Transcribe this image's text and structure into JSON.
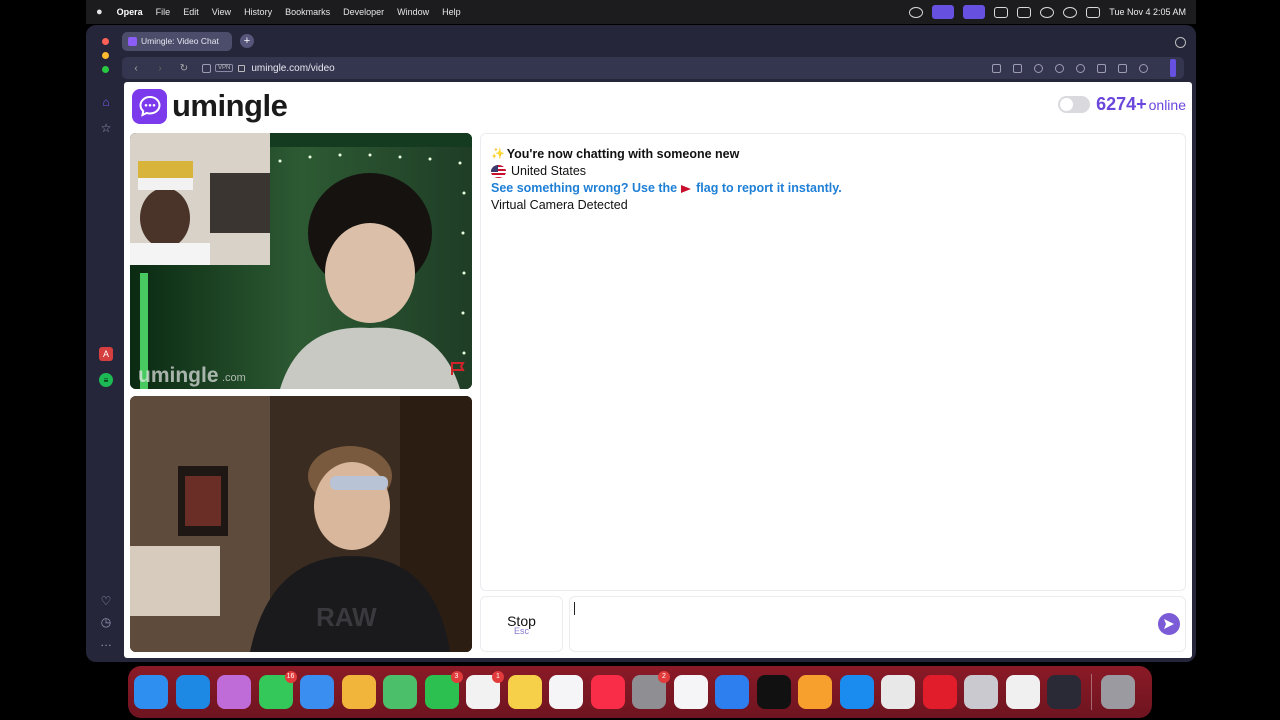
{
  "menubar": {
    "app": "Opera",
    "items": [
      "File",
      "Edit",
      "View",
      "History",
      "Bookmarks",
      "Developer",
      "Window",
      "Help"
    ],
    "clock": "Tue Nov 4  2:05 AM"
  },
  "browser": {
    "tab_title": "Umingle: Video Chat",
    "vpn_label": "VPN",
    "url": "umingle.com/video"
  },
  "site": {
    "brand": "umingle",
    "online_count": "6274+",
    "online_label": "online",
    "video_watermark": "umingle",
    "video_watermark_suffix": ".com"
  },
  "chat": {
    "sparkle": "✨",
    "connected_msg": "You're now chatting with someone new",
    "country": "United States",
    "report_pre": "See something wrong? Use the",
    "report_post": "flag to report it instantly.",
    "notice": "Virtual Camera Detected"
  },
  "controls": {
    "stop_label": "Stop",
    "stop_hint": "Esc"
  },
  "dock": {
    "apps": [
      {
        "name": "finder",
        "color": "#2f8ff0"
      },
      {
        "name": "safari",
        "color": "#1e88e5"
      },
      {
        "name": "launchpad",
        "color": "#c06cd8"
      },
      {
        "name": "messages",
        "color": "#34c759",
        "badge": "16"
      },
      {
        "name": "mail",
        "color": "#3a8ef0"
      },
      {
        "name": "photos",
        "color": "#f0b53a"
      },
      {
        "name": "maps",
        "color": "#4cbf6b"
      },
      {
        "name": "facetime",
        "color": "#2bc04f",
        "badge": "3"
      },
      {
        "name": "reminders",
        "color": "#f2f2f2",
        "badge": "1"
      },
      {
        "name": "notes",
        "color": "#f7d04a"
      },
      {
        "name": "freeform",
        "color": "#f5f5f7"
      },
      {
        "name": "music",
        "color": "#fa2d48"
      },
      {
        "name": "settings",
        "color": "#8e8e93",
        "badge": "2"
      },
      {
        "name": "news",
        "color": "#f5f5f7"
      },
      {
        "name": "keynote",
        "color": "#2d7ff0"
      },
      {
        "name": "apple-tv",
        "color": "#111111"
      },
      {
        "name": "pages",
        "color": "#f7a02d"
      },
      {
        "name": "app-store",
        "color": "#1a8cf0"
      },
      {
        "name": "chrome",
        "color": "#e8e8e8"
      },
      {
        "name": "opera",
        "color": "#e11d2b"
      },
      {
        "name": "iphone-mirroring",
        "color": "#c9c9cf"
      },
      {
        "name": "capcut",
        "color": "#f0f0f0"
      },
      {
        "name": "obs",
        "color": "#2a2a36"
      }
    ],
    "trash": {
      "name": "trash",
      "color": "#9a9aa0"
    }
  },
  "colors": {
    "accent": "#7c3aed",
    "online_text": "#6b46dd",
    "report_link": "#1e7fd6",
    "dock": "#8b1a27"
  }
}
